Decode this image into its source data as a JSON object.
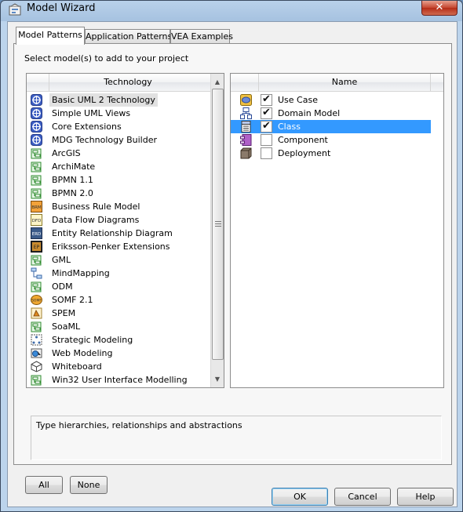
{
  "window": {
    "title": "Model Wizard",
    "close_label": "✕"
  },
  "tabs": [
    {
      "label": "Model Patterns",
      "active": true
    },
    {
      "label": "Application Patterns",
      "active": false
    },
    {
      "label": "VEA Examples",
      "active": false
    }
  ],
  "instruction": "Select model(s) to add to your project",
  "technology": {
    "header": "Technology",
    "items": [
      {
        "label": "Basic UML 2 Technology",
        "icon": "uml-technology-icon",
        "selected": true
      },
      {
        "label": "Simple UML Views",
        "icon": "uml-technology-icon"
      },
      {
        "label": "Core Extensions",
        "icon": "uml-technology-icon"
      },
      {
        "label": "MDG Technology Builder",
        "icon": "uml-technology-icon"
      },
      {
        "label": "ArcGIS",
        "icon": "package-icon"
      },
      {
        "label": "ArchiMate",
        "icon": "package-icon"
      },
      {
        "label": "BPMN 1.1",
        "icon": "package-icon"
      },
      {
        "label": "BPMN 2.0",
        "icon": "package-icon"
      },
      {
        "label": "Business Rule Model",
        "icon": "brm-icon"
      },
      {
        "label": "Data Flow Diagrams",
        "icon": "dfd-icon"
      },
      {
        "label": "Entity Relationship Diagram",
        "icon": "erd-icon"
      },
      {
        "label": "Eriksson-Penker Extensions",
        "icon": "ep-icon"
      },
      {
        "label": "GML",
        "icon": "package-icon"
      },
      {
        "label": "MindMapping",
        "icon": "mindmap-icon"
      },
      {
        "label": "ODM",
        "icon": "package-icon"
      },
      {
        "label": "SOMF 2.1",
        "icon": "somf-icon"
      },
      {
        "label": "SPEM",
        "icon": "spem-icon"
      },
      {
        "label": "SoaML",
        "icon": "package-icon"
      },
      {
        "label": "Strategic Modeling",
        "icon": "strategic-icon"
      },
      {
        "label": "Web Modeling",
        "icon": "web-icon"
      },
      {
        "label": "Whiteboard",
        "icon": "whiteboard-icon"
      },
      {
        "label": "Win32 User Interface Modelling",
        "icon": "package-icon"
      }
    ]
  },
  "models": {
    "header": "Name",
    "items": [
      {
        "label": "Use Case",
        "icon": "use-case-icon",
        "checked": true,
        "selected": false
      },
      {
        "label": "Domain Model",
        "icon": "domain-model-icon",
        "checked": true,
        "selected": false
      },
      {
        "label": "Class",
        "icon": "class-icon",
        "checked": true,
        "selected": true
      },
      {
        "label": "Component",
        "icon": "component-icon",
        "checked": false,
        "selected": false
      },
      {
        "label": "Deployment",
        "icon": "deployment-icon",
        "checked": false,
        "selected": false
      }
    ],
    "check_glyph": "✔"
  },
  "description": "Type hierarchies, relationships and abstractions",
  "buttons": {
    "all": "All",
    "none": "None",
    "ok": "OK",
    "cancel": "Cancel",
    "help": "Help"
  },
  "colors": {
    "selection": "#3399ff",
    "title_bar": "#b9d1ea"
  }
}
